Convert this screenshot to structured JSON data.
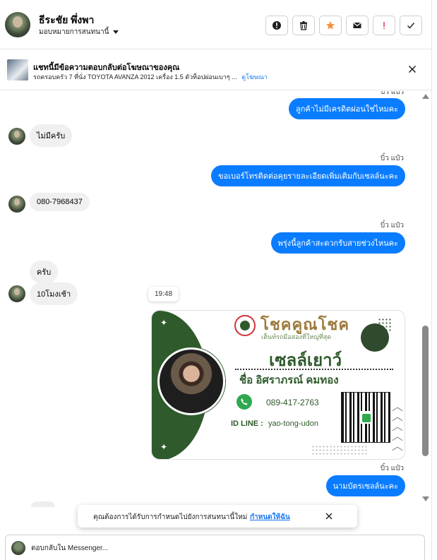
{
  "header": {
    "contact_name": "ธีระชัย พึ่งพา",
    "assign_label": "มอบหมายการสนทนานี้",
    "toolbar": [
      {
        "name": "report-button",
        "icon": "exclamation-circle-icon"
      },
      {
        "name": "delete-button",
        "icon": "trash-icon"
      },
      {
        "name": "star-button",
        "icon": "star-icon",
        "color": "#f7b928"
      },
      {
        "name": "mark-unread-button",
        "icon": "envelope-icon"
      },
      {
        "name": "spam-button",
        "icon": "exclamation-icon",
        "color": "#e4405f"
      },
      {
        "name": "done-button",
        "icon": "check-icon"
      }
    ]
  },
  "ad": {
    "title": "แชทนี้มีข้อความตอบกลับต่อโฆษณาของคุณ",
    "description": "รถครอบครัว 7 ที่นั่ง TOYOTA AVANZA 2012 เครื่อง 1.5 ตัวท็อปผ่อนเบาๆ ...",
    "link": "ดูโฆษณา"
  },
  "messages": {
    "m1_text": "ลูกค้าไม่มีเครดิตผ่อนใช่ไหมคะ",
    "m2_text": "ไม่มีครับ",
    "m3_sender": "บิ๋ว แป๋ว",
    "m3_text": "ขอเบอร์โทรติดต่อคุยรายละเอียดเพิ่มเติมกับเซลล์นะคะ",
    "m4_text": "080-7968437",
    "m5_sender": "บิ๋ว แป๋ว",
    "m5_text": "พรุ่งนี้ลูกค้าสะดวกรับสายช่วงไหนคะ",
    "m6_text": "ครับ",
    "m7_text": "10โมงเช้า",
    "timestamp": "19:48",
    "m9_sender": "บิ๋ว แป๋ว",
    "m9_text": "นามบัตรเซลล์นะคะ"
  },
  "card": {
    "brand_name": "โชคคูณโชค",
    "slogan": "เต็นท์รถมือสองที่ใหญ่ที่สุด",
    "title": "เซลล์เยาว์",
    "person": "ชื่อ อิศราภรณ์  คมทอง",
    "phone": "089-417-2763",
    "line_label": "ID LINE :",
    "line_id": "yao-tong-udon"
  },
  "notice": {
    "text": "คุณต้องการได้รับการกำหนดไปยังการสนทนานี้ใหม่",
    "action": "กำหนดให้ฉัน"
  },
  "composer": {
    "placeholder": "ตอบกลับใน Messenger..."
  },
  "colors": {
    "accent": "#0a7cff",
    "incoming_bubble": "#f0f0f0",
    "card_green": "#2f5a2c"
  }
}
